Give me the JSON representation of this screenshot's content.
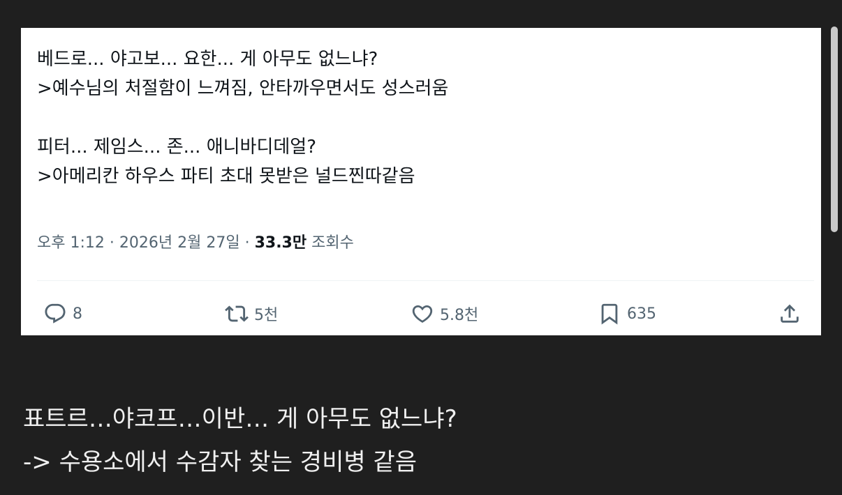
{
  "tweet": {
    "lines": [
      "베드로... 야고보... 요한... 게 아무도 없느냐?",
      ">예수님의 처절함이 느껴짐, 안타까우면서도 성스러움",
      "피터... 제임스... 존... 애니바디데얼?",
      ">아메리칸 하우스 파티 초대 못받은 널드찐따같음"
    ],
    "meta": {
      "time": "오후 1:12",
      "separator": "·",
      "date": "2026년 2월 27일",
      "views_count": "33.3만",
      "views_label": "조회수"
    },
    "actions": {
      "reply": {
        "icon": "reply-icon",
        "count": "8"
      },
      "retweet": {
        "icon": "retweet-icon",
        "count": "5천"
      },
      "like": {
        "icon": "heart-icon",
        "count": "5.8천"
      },
      "bookmark": {
        "icon": "bookmark-icon",
        "count": "635"
      },
      "share": {
        "icon": "share-icon"
      }
    }
  },
  "caption": {
    "line1": "표트르…야코프…이반… 게 아무도 없느냐?",
    "line2": "-> 수용소에서 수감자 찾는 경비병 같음"
  },
  "colors": {
    "background": "#1f1f1f",
    "card": "#ffffff",
    "tweet_text": "#0f1419",
    "secondary_text": "#536471",
    "caption_text": "#f0f0f0"
  }
}
